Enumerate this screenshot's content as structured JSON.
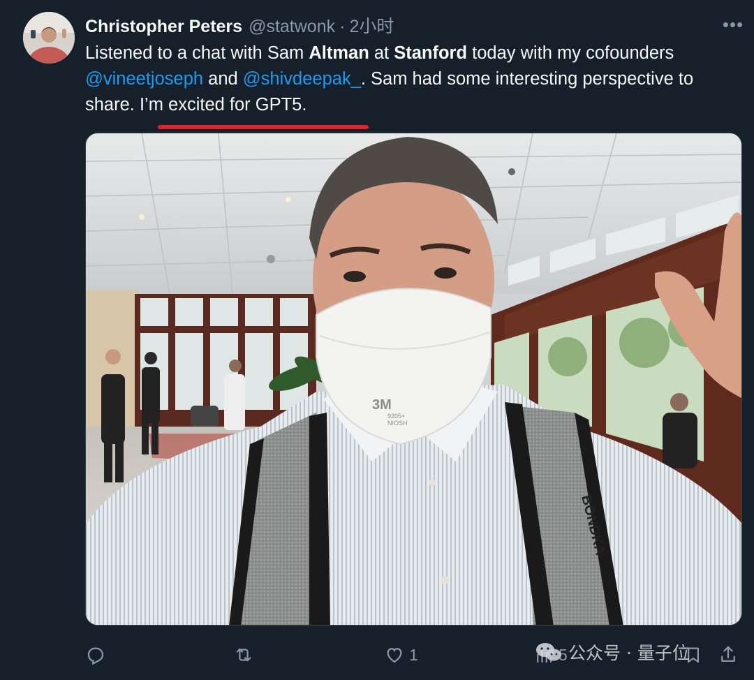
{
  "tweet": {
    "author_name": "Christopher Peters",
    "author_handle": "@statwonk",
    "separator": "·",
    "timestamp": "2小时",
    "more_label": "•••",
    "text": {
      "p1": "Listened to a chat with Sam ",
      "b1": "Altman",
      "p2": " at ",
      "b2": "Stanford",
      "p3": " today with my cofounders ",
      "mention1": "@vineetjoseph",
      "p4": " and ",
      "mention2": "@shivdeepak_",
      "p5": ". Sam had some interesting perspective to share. I’m excited for GPT5."
    },
    "highlight_color": "#e0232e",
    "accent_color": "#1d9bf0",
    "mask_print": {
      "brand": "3M",
      "model": "9205+",
      "cert": "NIOSH"
    },
    "bag_brand": "BONDKA"
  },
  "actions": {
    "reply_icon": "reply-icon",
    "retweet_icon": "retweet-icon",
    "like_icon": "heart-icon",
    "like_count": "1",
    "views_icon": "views-icon",
    "views_count": "5",
    "bookmark_icon": "bookmark-icon",
    "share_icon": "share-icon"
  },
  "watermark": {
    "icon": "wechat-icon",
    "text": "公众号 · 量子位"
  }
}
